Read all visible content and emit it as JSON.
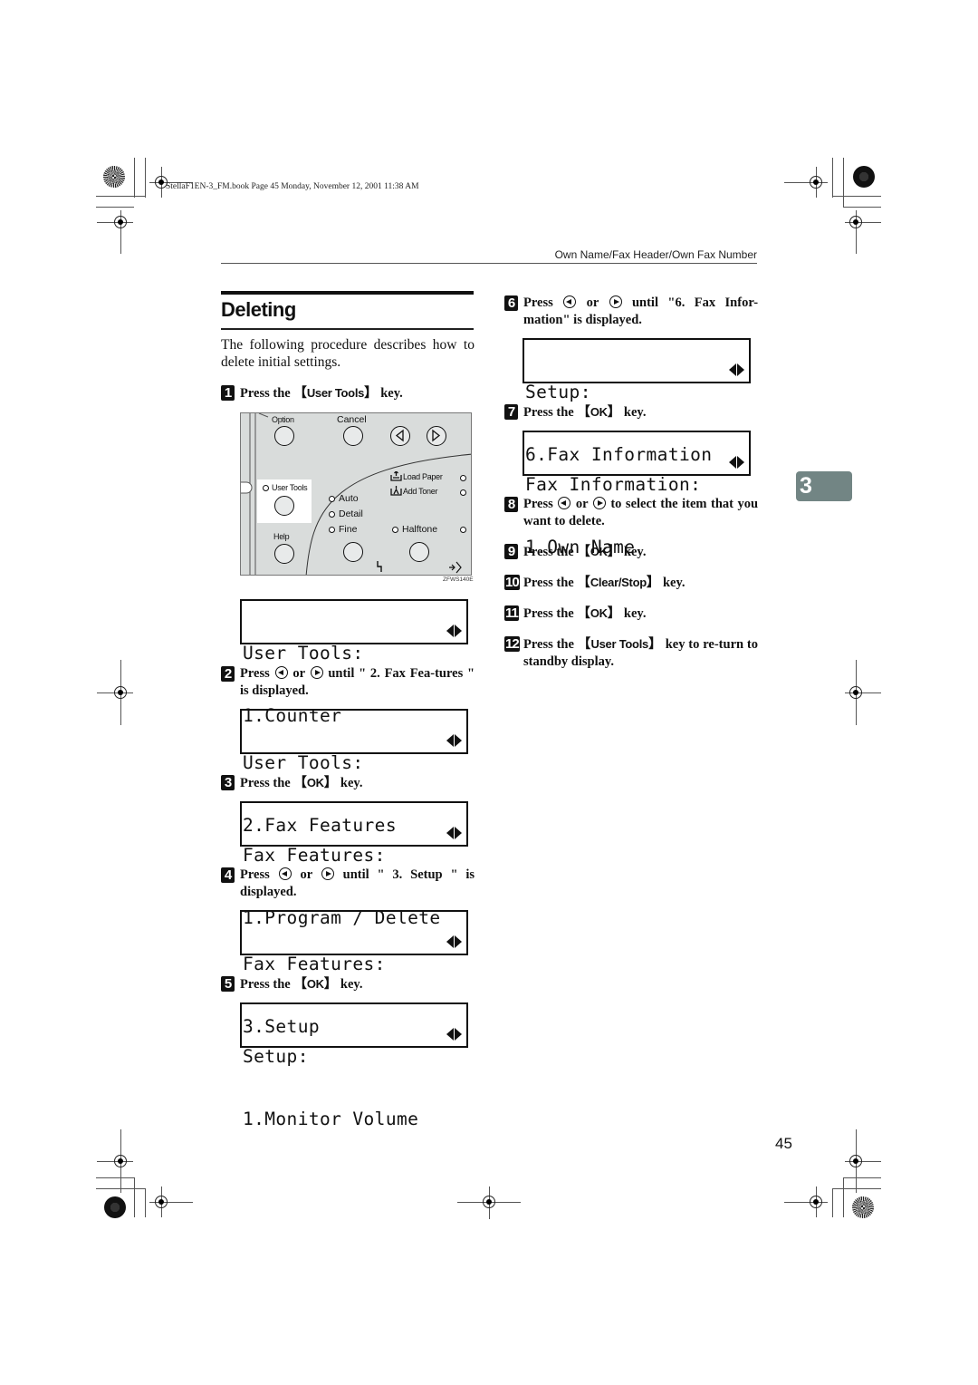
{
  "running_head": "StellaF1EN-3_FM.book  Page 45  Monday, November 12, 2001  11:38 AM",
  "header": {
    "title": "Own Name/Fax Header/Own Fax Number"
  },
  "section": {
    "title": "Deleting",
    "intro": "The following procedure describes how to delete initial settings."
  },
  "keys": {
    "user_tools": "User Tools",
    "ok": "OK",
    "clear_stop": "Clear/Stop"
  },
  "text": {
    "press": "Press",
    "press_the": "Press the",
    "key_end": "key.",
    "or": "or",
    "lbr": "【",
    "rbr": "】"
  },
  "steps": [
    {
      "num": "1",
      "after_key": "key."
    },
    {
      "num": "2",
      "after_arrows": "until \" 2. Fax Fea-tures \" is displayed."
    },
    {
      "num": "3"
    },
    {
      "num": "4",
      "after_arrows": "until \" 3. Setup \" is displayed."
    },
    {
      "num": "5"
    },
    {
      "num": "6",
      "after_arrows": "until \"6. Fax Infor-mation\" is displayed."
    },
    {
      "num": "7"
    },
    {
      "num": "8",
      "after_arrows": "to select the item that you want to delete."
    },
    {
      "num": "9"
    },
    {
      "num": "10"
    },
    {
      "num": "11"
    },
    {
      "num": "12",
      "after_key": "key to re-turn to standby display."
    }
  ],
  "displays": [
    {
      "line1": "User Tools:",
      "line2": "1.Counter"
    },
    {
      "line1": "User Tools:",
      "line2": "2.Fax Features"
    },
    {
      "line1": "Fax Features:",
      "line2": "1.Program / Delete"
    },
    {
      "line1": "Fax Features:",
      "line2": "3.Setup"
    },
    {
      "line1": "Setup:",
      "line2": "1.Monitor Volume"
    },
    {
      "line1": "Setup:",
      "line2": "6.Fax Information"
    },
    {
      "line1": "Fax Information:",
      "line2": "1.Own Name"
    }
  ],
  "panel": {
    "option": "Option",
    "cancel": "Cancel",
    "user_tools": "User Tools",
    "help": "Help",
    "load_paper": "Load Paper",
    "add_toner": "Add Toner",
    "auto": "Auto",
    "detail": "Detail",
    "fine": "Fine",
    "halftone": "Halftone",
    "figure_code": "ZFWS140E"
  },
  "chapter_tab": "3",
  "page_number": "45"
}
